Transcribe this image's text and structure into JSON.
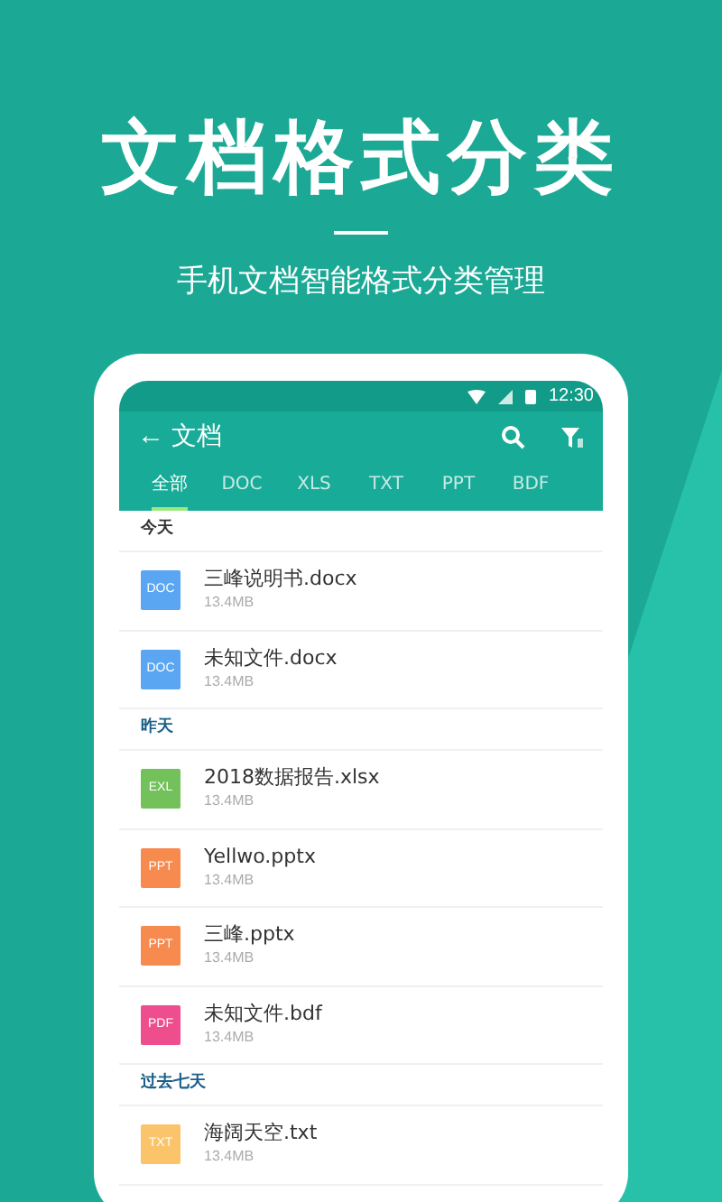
{
  "headline": "文档格式分类",
  "subtitle": "手机文档智能格式分类管理",
  "status_bar": {
    "time": "12:30"
  },
  "app_bar": {
    "back": "←",
    "title": "文档"
  },
  "tabs": [
    {
      "label": "全部",
      "selected": true
    },
    {
      "label": "DOC",
      "selected": false
    },
    {
      "label": "XLS",
      "selected": false
    },
    {
      "label": "TXT",
      "selected": false
    },
    {
      "label": "PPT",
      "selected": false
    },
    {
      "label": "BDF",
      "selected": false
    }
  ],
  "sections": [
    {
      "title": "今天",
      "files": [
        {
          "badge": "DOC",
          "color": "#5aa6f2",
          "name": "三峰说明书.docx",
          "size": "13.4MB"
        },
        {
          "badge": "DOC",
          "color": "#5aa6f2",
          "name": "未知文件.docx",
          "size": "13.4MB"
        }
      ]
    },
    {
      "title": "昨天",
      "files": [
        {
          "badge": "EXL",
          "color": "#72c15a",
          "name": "2018数据报告.xlsx",
          "size": "13.4MB"
        },
        {
          "badge": "PPT",
          "color": "#f68a4f",
          "name": "Yellwo.pptx",
          "size": "13.4MB"
        },
        {
          "badge": "PPT",
          "color": "#f68a4f",
          "name": "三峰.pptx",
          "size": "13.4MB"
        },
        {
          "badge": "PDF",
          "color": "#ee4e8d",
          "name": "未知文件.bdf",
          "size": "13.4MB"
        }
      ]
    },
    {
      "title": "过去七天",
      "files": [
        {
          "badge": "TXT",
          "color": "#fbc46a",
          "name": "海阔天空.txt",
          "size": "13.4MB"
        }
      ]
    }
  ]
}
